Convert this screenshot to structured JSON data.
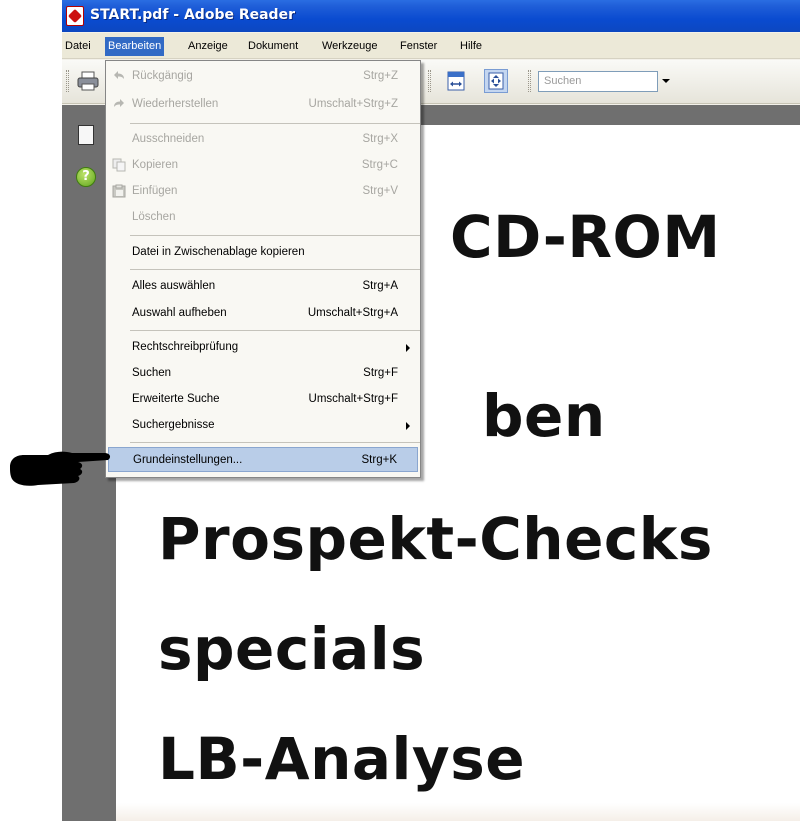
{
  "window": {
    "title": "START.pdf - Adobe Reader"
  },
  "menubar": {
    "items": [
      {
        "label": "Datei"
      },
      {
        "label": "Bearbeiten",
        "active": true
      },
      {
        "label": "Anzeige"
      },
      {
        "label": "Dokument"
      },
      {
        "label": "Werkzeuge"
      },
      {
        "label": "Fenster"
      },
      {
        "label": "Hilfe"
      }
    ]
  },
  "toolbar": {
    "search_placeholder": "Suchen",
    "icons": [
      "print-icon",
      "fit-width-icon",
      "fit-page-icon"
    ]
  },
  "edit_menu": {
    "items": [
      {
        "label": "Rückgängig",
        "shortcut": "Strg+Z",
        "disabled": true,
        "icon": "undo-icon"
      },
      {
        "label": "Wiederherstellen",
        "shortcut": "Umschalt+Strg+Z",
        "disabled": true,
        "icon": "redo-icon"
      },
      {
        "label": "Ausschneiden",
        "shortcut": "Strg+X",
        "disabled": true
      },
      {
        "label": "Kopieren",
        "shortcut": "Strg+C",
        "disabled": true,
        "icon": "copy-icon"
      },
      {
        "label": "Einfügen",
        "shortcut": "Strg+V",
        "disabled": true,
        "icon": "paste-icon"
      },
      {
        "label": "Löschen",
        "shortcut": "",
        "disabled": true
      },
      {
        "label": "Datei in Zwischenablage kopieren",
        "shortcut": ""
      },
      {
        "label": "Alles auswählen",
        "shortcut": "Strg+A"
      },
      {
        "label": "Auswahl aufheben",
        "shortcut": "Umschalt+Strg+A"
      },
      {
        "label": "Rechtschreibprüfung",
        "shortcut": "",
        "submenu": true
      },
      {
        "label": "Suchen",
        "shortcut": "Strg+F"
      },
      {
        "label": "Erweiterte Suche",
        "shortcut": "Umschalt+Strg+F"
      },
      {
        "label": "Suchergebnisse",
        "shortcut": "",
        "submenu": true
      },
      {
        "label": "Grundeinstellungen...",
        "shortcut": "Strg+K",
        "highlighted": true
      }
    ]
  },
  "document": {
    "lines": [
      "CD-ROM",
      "ben",
      "Prospekt-Checks",
      "specials",
      "LB-Analyse"
    ]
  },
  "colors": {
    "titlebar": "#0a4bd0",
    "menu_highlight": "#316ac5",
    "item_highlight": "#b9cde8",
    "sidebar": "#6f6f6f"
  }
}
